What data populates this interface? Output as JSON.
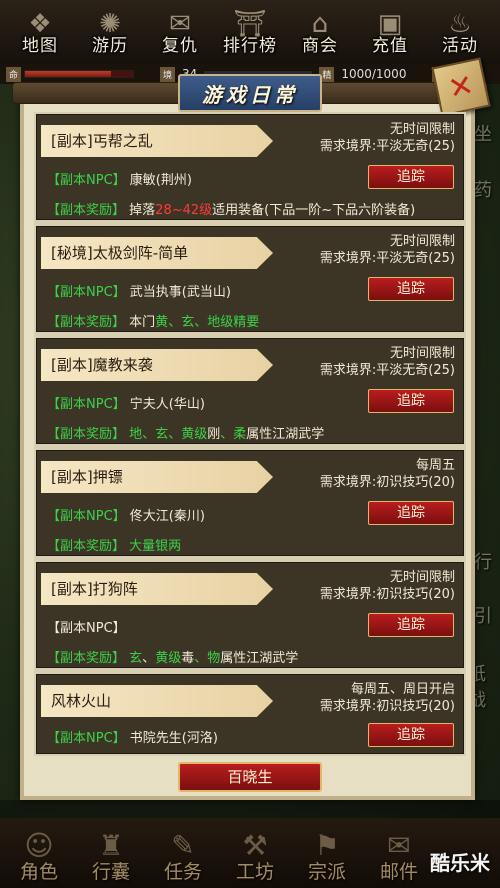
{
  "top_nav": [
    {
      "label": "地图",
      "icon": "map-icon"
    },
    {
      "label": "游历",
      "icon": "wheel-icon"
    },
    {
      "label": "复仇",
      "icon": "scroll-icon"
    },
    {
      "label": "排行榜",
      "icon": "gate-icon"
    },
    {
      "label": "商会",
      "icon": "house-icon"
    },
    {
      "label": "充值",
      "icon": "chest-icon"
    },
    {
      "label": "活动",
      "icon": "gourd-icon"
    }
  ],
  "status": {
    "hp_tag": "命",
    "realm_tag": "境",
    "level": "34",
    "energy_tag": "精",
    "energy": "1000/1000",
    "skill_tag": "功"
  },
  "panel": {
    "title": "游戏日常",
    "close_icon": "close-icon",
    "bottom_button": "百晓生"
  },
  "entries": [
    {
      "name": "[副本]丐帮之乱",
      "limit": "无时间限制",
      "realm": "需求境界:平淡无奇(25)",
      "npc_tag": "【副本NPC】",
      "npc": "康敏(荆州)",
      "reward_tag": "【副本奖励】",
      "reward_parts": [
        {
          "text": "掉落",
          "color": "white"
        },
        {
          "text": "28~42级",
          "color": "red"
        },
        {
          "text": "适用装备(下品一阶~下品六阶装备)",
          "color": "white"
        }
      ],
      "track": "追踪"
    },
    {
      "name": "[秘境]太极剑阵-简单",
      "limit": "无时间限制",
      "realm": "需求境界:平淡无奇(25)",
      "npc_tag": "【副本NPC】",
      "npc": "武当执事(武当山)",
      "reward_tag": "【副本奖励】",
      "reward_parts": [
        {
          "text": "本门",
          "color": "white"
        },
        {
          "text": "黄",
          "color": "yellow"
        },
        {
          "text": "、",
          "color": "green"
        },
        {
          "text": "玄",
          "color": "green"
        },
        {
          "text": "、地级精要",
          "color": "green"
        }
      ],
      "track": "追踪"
    },
    {
      "name": "[副本]魔教来袭",
      "limit": "无时间限制",
      "realm": "需求境界:平淡无奇(25)",
      "npc_tag": "【副本NPC】",
      "npc": "宁夫人(华山)",
      "reward_tag": "【副本奖励】",
      "reward_parts": [
        {
          "text": "地",
          "color": "green"
        },
        {
          "text": "、",
          "color": "green"
        },
        {
          "text": "玄",
          "color": "green"
        },
        {
          "text": "、",
          "color": "green"
        },
        {
          "text": "黄级",
          "color": "green"
        },
        {
          "text": "刚",
          "color": "white"
        },
        {
          "text": "、",
          "color": "green"
        },
        {
          "text": "柔",
          "color": "green"
        },
        {
          "text": "属性江湖武学",
          "color": "white"
        }
      ],
      "track": "追踪"
    },
    {
      "name": "[副本]押镖",
      "limit": "每周五",
      "realm": "需求境界:初识技巧(20)",
      "npc_tag": "【副本NPC】",
      "npc": "佟大江(秦川)",
      "reward_tag": "【副本奖励】",
      "reward_parts": [
        {
          "text": "大量银两",
          "color": "green"
        }
      ],
      "track": "追踪"
    },
    {
      "name": "[副本]打狗阵",
      "limit": "无时间限制",
      "realm": "需求境界:初识技巧(20)",
      "npc_tag": "【副本NPC】",
      "npc": "",
      "reward_tag": "【副本奖励】",
      "reward_parts": [
        {
          "text": "玄",
          "color": "green"
        },
        {
          "text": "、",
          "color": "white"
        },
        {
          "text": "黄级",
          "color": "green"
        },
        {
          "text": "毒",
          "color": "white"
        },
        {
          "text": "、",
          "color": "green"
        },
        {
          "text": "物",
          "color": "green"
        },
        {
          "text": "属性江湖武学",
          "color": "white"
        }
      ],
      "track": "追踪"
    },
    {
      "name": "风林火山",
      "limit": "每周五、周日开启",
      "realm": "需求境界:初识技巧(20)",
      "npc_tag": "【副本NPC】",
      "npc": "书院先生(河洛)",
      "reward_tag": "",
      "reward_parts": [],
      "track": "追踪"
    }
  ],
  "side_text": [
    "坐",
    "药",
    "行",
    "引",
    "纸战"
  ],
  "bottom_nav": [
    {
      "label": "角色",
      "icon": "hero-icon"
    },
    {
      "label": "行囊",
      "icon": "bag-icon"
    },
    {
      "label": "任务",
      "icon": "scroll-icon"
    },
    {
      "label": "工坊",
      "icon": "anvil-icon"
    },
    {
      "label": "宗派",
      "icon": "banner-icon"
    },
    {
      "label": "邮件",
      "icon": "mail-icon"
    }
  ],
  "watermark": "酷乐米",
  "colors": {
    "red": "#ff3a3a",
    "green": "#3bd24a",
    "white": "#f2ead6",
    "yellow": "#f2ead6"
  }
}
